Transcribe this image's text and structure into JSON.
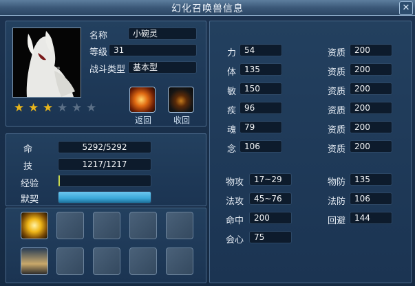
{
  "window": {
    "title": "幻化召唤兽信息",
    "close_label": "✕"
  },
  "pet": {
    "name_label": "名称",
    "name": "小碗灵",
    "level_label": "等级",
    "level": "31",
    "type_label": "战斗类型",
    "type": "基本型",
    "stars_total": 6,
    "stars_filled": 3
  },
  "actions": {
    "return_label": "返回",
    "recall_label": "收回"
  },
  "vitals": {
    "hp_label": "命",
    "hp": "5292/5292",
    "mp_label": "技",
    "mp": "1217/1217",
    "exp_label": "经验",
    "exp_fraction": 0.01,
    "loyalty_label": "默契",
    "loyalty_fraction": 1.0
  },
  "attributes": [
    {
      "label": "力",
      "value": "54",
      "apt_label": "资质",
      "apt": "200"
    },
    {
      "label": "体",
      "value": "135",
      "apt_label": "资质",
      "apt": "200"
    },
    {
      "label": "敏",
      "value": "150",
      "apt_label": "资质",
      "apt": "200"
    },
    {
      "label": "疾",
      "value": "96",
      "apt_label": "资质",
      "apt": "200"
    },
    {
      "label": "魂",
      "value": "79",
      "apt_label": "资质",
      "apt": "200"
    },
    {
      "label": "念",
      "value": "106",
      "apt_label": "资质",
      "apt": "200"
    }
  ],
  "combat": {
    "patk_label": "物攻",
    "patk": "17~29",
    "pdef_label": "物防",
    "pdef": "135",
    "matk_label": "法攻",
    "matk": "45~76",
    "mdef_label": "法防",
    "mdef": "106",
    "hit_label": "命中",
    "hit": "200",
    "dodge_label": "回避",
    "dodge": "144",
    "crit_label": "会心",
    "crit": "75"
  },
  "colors": {
    "star_on": "#e8b51c",
    "star_off": "#5b6f86",
    "exp_fill": "#c8d84a",
    "loyalty_fill": "#3aa7d8"
  },
  "icons": {
    "portrait": "white-fox-portrait",
    "return": "fire-swirl-icon",
    "recall": "dark-beast-icon"
  }
}
